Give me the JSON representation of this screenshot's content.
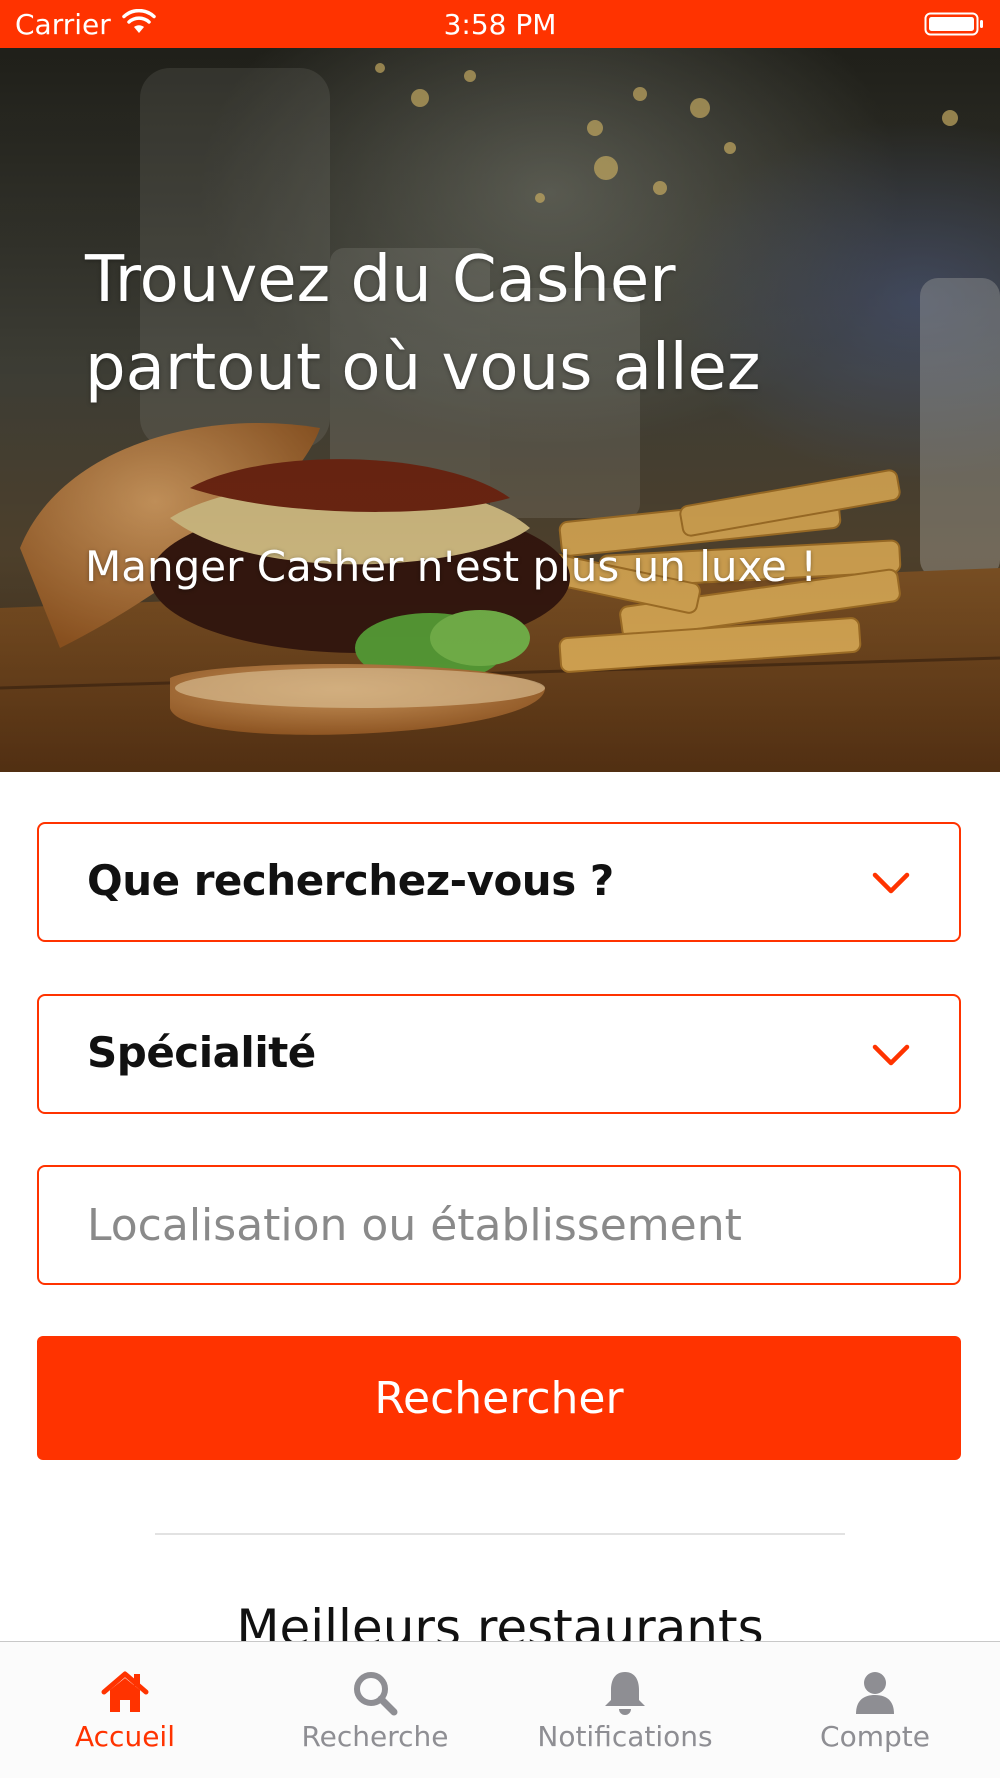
{
  "colors": {
    "accent": "#ff3300",
    "tab_inactive": "#8e8e93",
    "placeholder": "#8a8a8a"
  },
  "status_bar": {
    "carrier": "Carrier",
    "time": "3:58 PM",
    "icons": [
      "wifi-icon",
      "battery-icon"
    ]
  },
  "hero": {
    "image": "burger-and-fries-photo",
    "title": "Trouvez du Casher partout où vous allez",
    "subtitle": "Manger Casher n'est plus un luxe !"
  },
  "search_form": {
    "category_select": {
      "label": "Que recherchez-vous ?",
      "icon": "chevron-down-icon"
    },
    "specialty_select": {
      "label": "Spécialité",
      "icon": "chevron-down-icon"
    },
    "location_input": {
      "placeholder": "Localisation ou établissement",
      "value": ""
    },
    "submit_label": "Rechercher"
  },
  "section": {
    "title": "Meilleurs restaurants"
  },
  "tab_bar": {
    "active": "Accueil",
    "tabs": [
      {
        "label": "Accueil",
        "icon": "home-icon"
      },
      {
        "label": "Recherche",
        "icon": "search-icon"
      },
      {
        "label": "Notifications",
        "icon": "bell-icon"
      },
      {
        "label": "Compte",
        "icon": "user-icon"
      }
    ]
  }
}
